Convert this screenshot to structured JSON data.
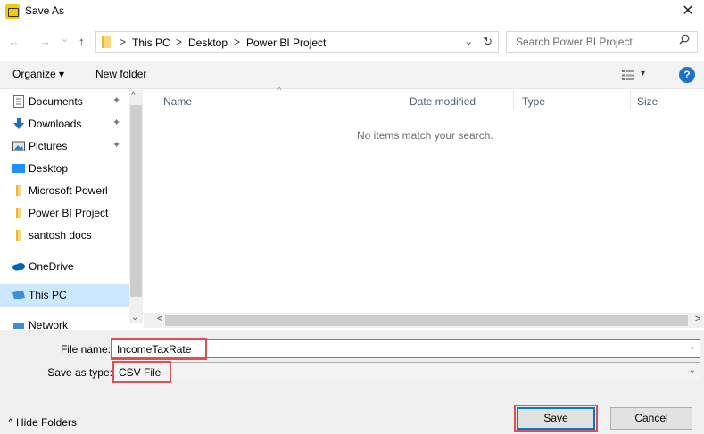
{
  "window": {
    "title": "Save As",
    "close_glyph": "✕"
  },
  "nav": {
    "back_glyph": "←",
    "forward_glyph": "→",
    "recent_glyph": "⌄",
    "up_glyph": "↑",
    "breadcrumb": [
      "This PC",
      "Desktop",
      "Power BI Project"
    ],
    "sep_glyph": ">",
    "dropdown_glyph": "⌄",
    "refresh_glyph": "↻"
  },
  "search": {
    "placeholder": "Search Power BI Project"
  },
  "toolbar": {
    "organize_label": "Organize ▾",
    "new_folder_label": "New folder",
    "view_dd_glyph": "▾",
    "help_glyph": "?"
  },
  "sidebar": {
    "items": [
      {
        "label": "Documents",
        "icon": "documents-icon",
        "pinned": true,
        "color": "#6b6b6b"
      },
      {
        "label": "Downloads",
        "icon": "downloads-icon",
        "pinned": true,
        "color": "#1f6fc5"
      },
      {
        "label": "Pictures",
        "icon": "pictures-icon",
        "pinned": true,
        "color": "#2e7fcf"
      },
      {
        "label": "Desktop",
        "icon": "desktop-icon",
        "pinned": false,
        "color": "#1e90ff"
      },
      {
        "label": "Microsoft Powerl",
        "icon": "folder-icon",
        "pinned": false,
        "color": "#f8d775"
      },
      {
        "label": "Power BI Project",
        "icon": "folder-icon",
        "pinned": false,
        "color": "#f8d775"
      },
      {
        "label": "santosh docs",
        "icon": "folder-icon",
        "pinned": false,
        "color": "#f8d775"
      },
      {
        "label": "OneDrive",
        "icon": "onedrive-icon",
        "pinned": false,
        "color": "#0364b8"
      },
      {
        "label": "This PC",
        "icon": "this-pc-icon",
        "pinned": false,
        "color": "#3c8fd8",
        "selected": true
      },
      {
        "label": "Network",
        "icon": "network-icon",
        "pinned": false,
        "color": "#3c8fd8"
      }
    ],
    "pin_glyph": "📌",
    "scroll_up_glyph": "^",
    "scroll_down_glyph": "⌄"
  },
  "filelist": {
    "columns": [
      "Name",
      "Date modified",
      "Type",
      "Size"
    ],
    "sort_glyph": "^",
    "empty_message": "No items match your search.",
    "scroll_left_glyph": "<",
    "scroll_right_glyph": ">"
  },
  "form": {
    "filename_label": "File name:",
    "filename_value": "IncomeTaxRate",
    "savetype_label": "Save as type:",
    "savetype_value": "CSV File",
    "dd_glyph": "⌄"
  },
  "footer": {
    "hide_folders_label": "^  Hide Folders",
    "save_label": "Save",
    "cancel_label": "Cancel"
  },
  "colors": {
    "accent": "#0078d7",
    "highlight": "#e05050",
    "selected_bg": "#cce8ff",
    "help": "#1a73c9"
  }
}
